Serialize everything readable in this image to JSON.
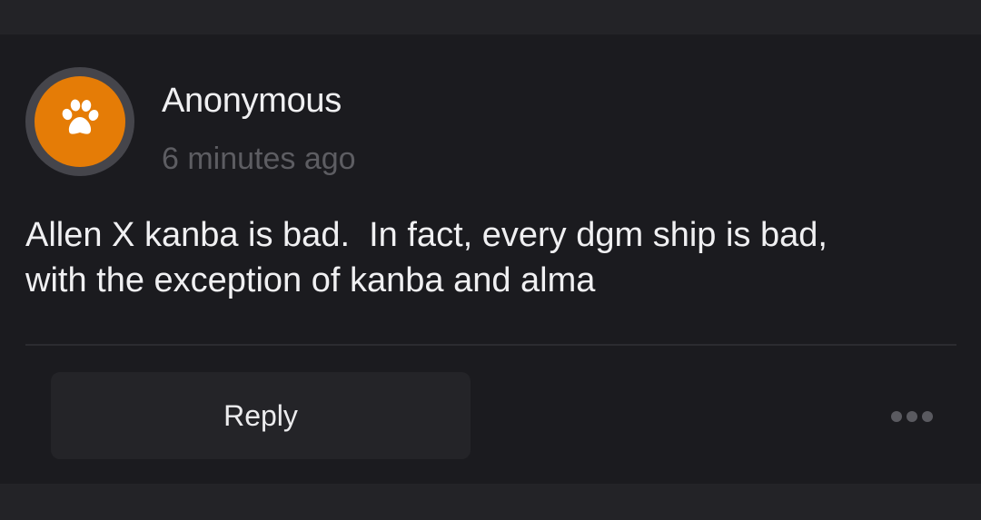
{
  "comment": {
    "author": "Anonymous",
    "timestamp": "6 minutes ago",
    "body": "Allen X kanba is bad.  In fact, every dgm ship is bad,\nwith the exception of kanba and alma",
    "avatar": {
      "icon": "paw-icon",
      "background_color": "#e57c06",
      "ring_color": "#45454b"
    }
  },
  "actions": {
    "reply_label": "Reply",
    "more_icon": "more-horizontal-icon"
  }
}
